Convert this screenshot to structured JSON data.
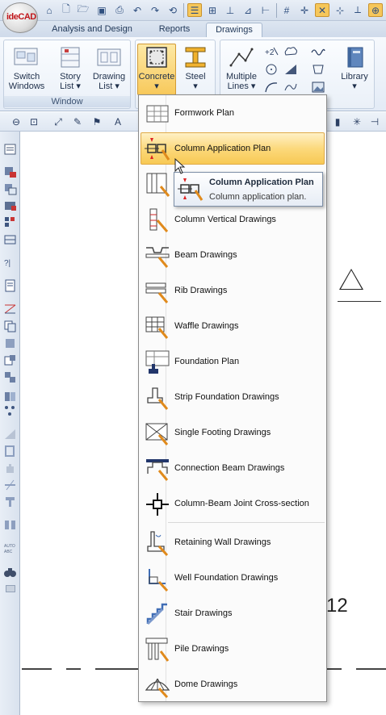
{
  "app": {
    "logo_text": "ideCAD"
  },
  "tabs": [
    {
      "label": "Analysis and Design",
      "active": false
    },
    {
      "label": "Reports",
      "active": false
    },
    {
      "label": "Drawings",
      "active": true
    }
  ],
  "ribbon": {
    "window_group": {
      "label": "Window",
      "buttons": [
        {
          "line1": "Switch",
          "line2": "Windows"
        },
        {
          "line1": "Story",
          "line2": "List ▾"
        },
        {
          "line1": "Drawing",
          "line2": "List ▾"
        }
      ]
    },
    "concrete": {
      "line1": "Concrete",
      "line2": "▾"
    },
    "steel": {
      "line1": "Steel",
      "line2": "▾"
    },
    "multiple_lines": {
      "line1": "Multiple",
      "line2": "Lines ▾"
    },
    "library": {
      "line1": "Library",
      "line2": "▾"
    }
  },
  "menu": {
    "items": [
      {
        "label": "Formwork Plan",
        "icon": "formwork-plan-icon"
      },
      {
        "label": "Column Application Plan",
        "icon": "column-application-plan-icon",
        "hover": true
      },
      {
        "label": "",
        "icon": "column-detail-icon"
      },
      {
        "label": "Column Vertical Drawings",
        "icon": "column-vertical-icon"
      },
      {
        "label": "Beam Drawings",
        "icon": "beam-drawings-icon"
      },
      {
        "label": "Rib Drawings",
        "icon": "rib-drawings-icon"
      },
      {
        "label": "Waffle Drawings",
        "icon": "waffle-drawings-icon"
      },
      {
        "label": "Foundation Plan",
        "icon": "foundation-plan-icon"
      },
      {
        "label": "Strip Foundation Drawings",
        "icon": "strip-foundation-icon"
      },
      {
        "label": "Single Footing Drawings",
        "icon": "single-footing-icon"
      },
      {
        "label": "Connection Beam Drawings",
        "icon": "connection-beam-icon"
      },
      {
        "label": "Column-Beam Joint Cross-section",
        "icon": "joint-cross-section-icon"
      },
      {
        "label": "Retaining Wall Drawings",
        "icon": "retaining-wall-icon"
      },
      {
        "label": "Well Foundation Drawings",
        "icon": "well-foundation-icon"
      },
      {
        "label": "Stair Drawings",
        "icon": "stair-drawings-icon"
      },
      {
        "label": "Pile Drawings",
        "icon": "pile-drawings-icon"
      },
      {
        "label": "Dome Drawings",
        "icon": "dome-drawings-icon"
      }
    ]
  },
  "tooltip": {
    "title": "Column Application Plan",
    "description": "Column application plan."
  },
  "canvas": {
    "label": "12"
  },
  "colors": {
    "accent": "#f8c95b",
    "ribbon": "#e3ebf6",
    "tooltip_border": "#7c8ea6"
  }
}
